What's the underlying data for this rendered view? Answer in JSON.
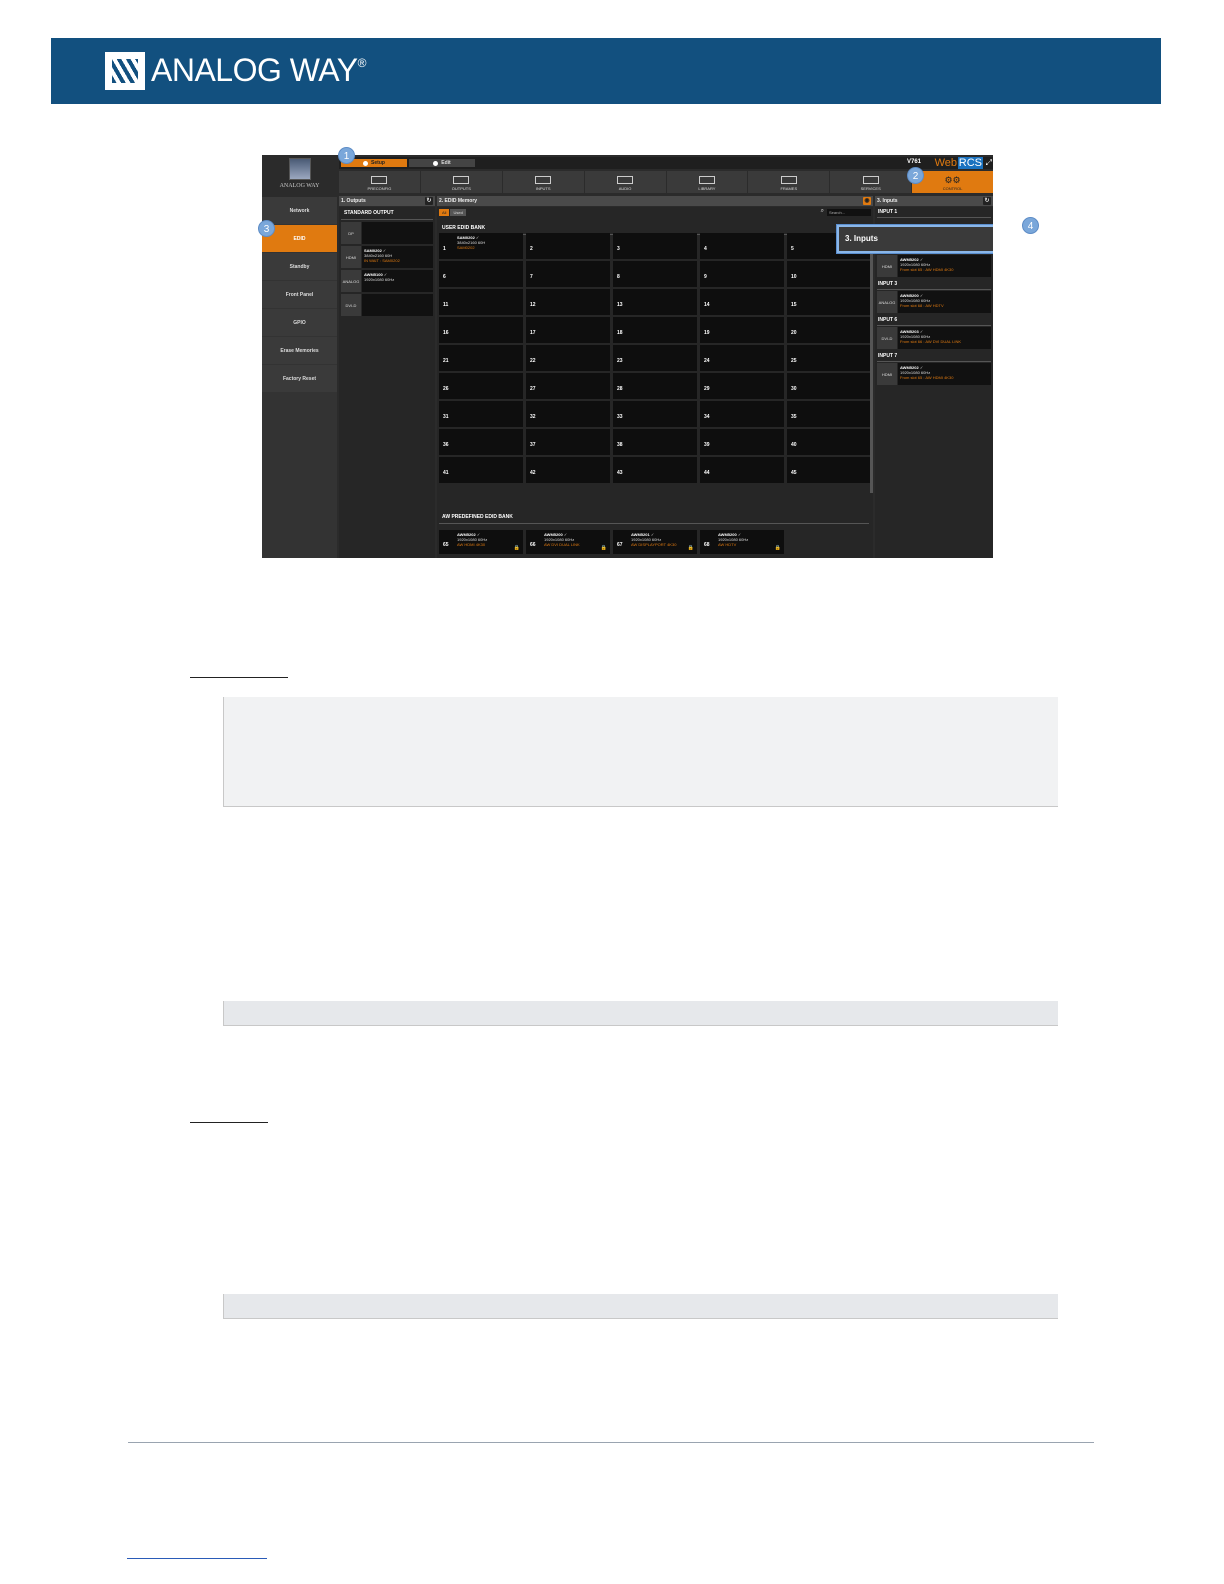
{
  "header": {
    "brand": "ANALOG WAY",
    "registered": "®"
  },
  "screenshot": {
    "brand_small": "ANALOG WAY",
    "modes": [
      "Setup",
      "Edit"
    ],
    "version": "V761",
    "app_name_web": "Web",
    "app_name_rcs": "RCS",
    "menu": [
      {
        "label": "PRECONFIG",
        "icon": "preconfig-icon"
      },
      {
        "label": "OUTPUTS",
        "icon": "outputs-icon"
      },
      {
        "label": "INPUTS",
        "icon": "inputs-icon"
      },
      {
        "label": "AUDIO",
        "icon": "audio-icon"
      },
      {
        "label": "LIBRARY",
        "icon": "library-icon"
      },
      {
        "label": "FRAMES",
        "icon": "frames-icon"
      },
      {
        "label": "SERVICES",
        "icon": "services-icon"
      },
      {
        "label": "CONTROL",
        "icon": "gears-icon"
      }
    ],
    "sidebar": [
      "Network",
      "EDID",
      "Standby",
      "Front Panel",
      "GPIO",
      "Erase Memories",
      "Factory Reset"
    ],
    "outputs_panel": {
      "title": "1. Outputs",
      "section": "STANDARD OUTPUT",
      "rows": [
        {
          "tag": "DP",
          "name": "",
          "res": "",
          "note": ""
        },
        {
          "tag": "HDMI",
          "name": "SAM0202",
          "res": "3840x2160 60H",
          "note": "IN WAIT : SAM0202"
        },
        {
          "tag": "ANALOG",
          "name": "AWM5100",
          "res": "1920x1080 60Hz",
          "note": ""
        },
        {
          "tag": "DVI-D",
          "name": "",
          "res": "",
          "note": ""
        }
      ]
    },
    "memory_panel": {
      "title": "2. EDID Memory",
      "tabs": [
        "All",
        "Used"
      ],
      "search_placeholder": "Search...",
      "user_bank_title": "USER EDID BANK",
      "first_cell": {
        "name": "SAM0202",
        "res": "3840x2160 60H",
        "note": "SAM0202"
      },
      "cells": [
        "1",
        "2",
        "3",
        "4",
        "5",
        "6",
        "7",
        "8",
        "9",
        "10",
        "11",
        "12",
        "13",
        "14",
        "15",
        "16",
        "17",
        "18",
        "19",
        "20",
        "21",
        "22",
        "23",
        "24",
        "25",
        "26",
        "27",
        "28",
        "29",
        "30",
        "31",
        "32",
        "33",
        "34",
        "35",
        "36",
        "37",
        "38",
        "39",
        "40",
        "41",
        "42",
        "43",
        "44",
        "45"
      ],
      "predefined_title": "AW PREDEFINED EDID BANK",
      "predefined": [
        {
          "n": "65",
          "name": "AWM5202",
          "res": "1920x1080 60Hz",
          "note": "AW HDMI 4K30"
        },
        {
          "n": "66",
          "name": "AWM5200",
          "res": "1920x1080 60Hz",
          "note": "AW DVI DUAL LINK"
        },
        {
          "n": "67",
          "name": "AWM5201",
          "res": "1920x1080 60Hz",
          "note": "AW DISPLAYPORT 4K30"
        },
        {
          "n": "68",
          "name": "AWM5200",
          "res": "1920x1080 60Hz",
          "note": "AW HDTV"
        }
      ]
    },
    "inputs_panel": {
      "title": "3. Inputs",
      "blocks": [
        {
          "label": "INPUT 1",
          "tag": "",
          "name": "",
          "res": "",
          "note": ""
        },
        {
          "label": "INPUT 2",
          "tag": "HDMI",
          "name": "AWM5202",
          "res": "1920x1080 60Hz",
          "note": "From slot 65 : AW HDMI 4K30"
        },
        {
          "label": "INPUT 3",
          "tag": "ANALOG",
          "name": "AWM5200",
          "res": "1920x1080 60Hz",
          "note": "From slot 68 : AW HDTV"
        },
        {
          "label": "INPUT 6",
          "tag": "DVI-D",
          "name": "AWM5203",
          "res": "1920x1080 60Hz",
          "note": "From slot 66 : AW DVI DUAL LINK"
        },
        {
          "label": "INPUT 7",
          "tag": "HDMI",
          "name": "AWM5202",
          "res": "1920x1080 60Hz",
          "note": "From slot 65 : AW HDMI 4K30"
        }
      ]
    },
    "callout_title": "3. Inputs",
    "badges": [
      "1",
      "2",
      "3",
      "4"
    ]
  },
  "colors": {
    "banner": "#12507f",
    "accent_orange": "#e07a10",
    "callout_blue": "#7aa7da"
  }
}
